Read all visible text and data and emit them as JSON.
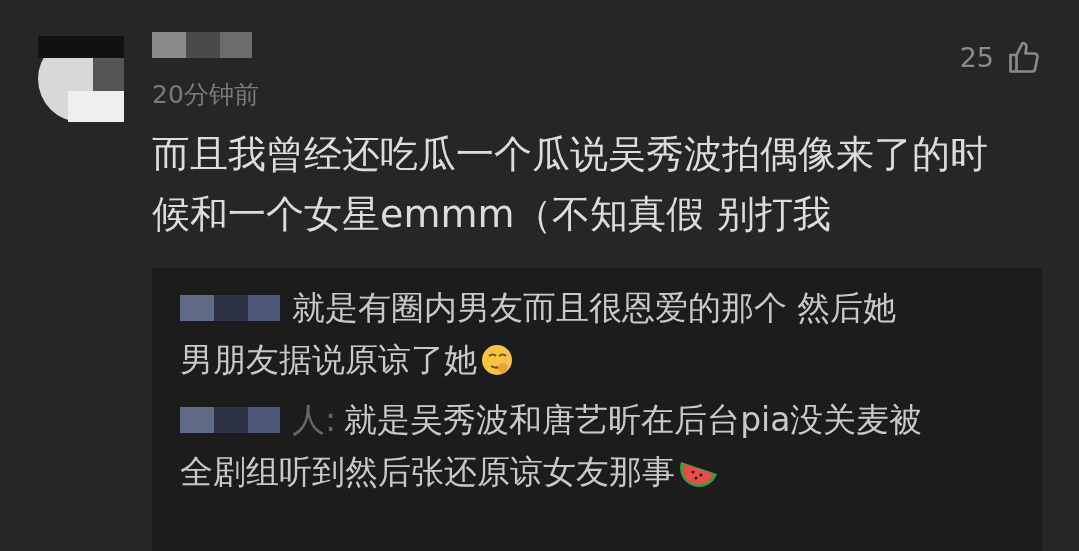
{
  "comment": {
    "time": "20分钟前",
    "likes": "25",
    "text": "而且我曾经还吃瓜一个瓜说吴秀波拍偶像来了的时候和一个女星emmm（不知真假 别打我"
  },
  "replies": [
    {
      "lines": [
        "就是有圈内男友而且很恩爱的那个 然后她",
        "男朋友据说原谅了她"
      ],
      "kind": "face"
    },
    {
      "author_visible": "人:",
      "lines": [
        "就是吴秀波和唐艺昕在后台pia没关麦被",
        "全剧组听到然后张还原谅女友那事"
      ],
      "kind": "watermelon"
    }
  ]
}
